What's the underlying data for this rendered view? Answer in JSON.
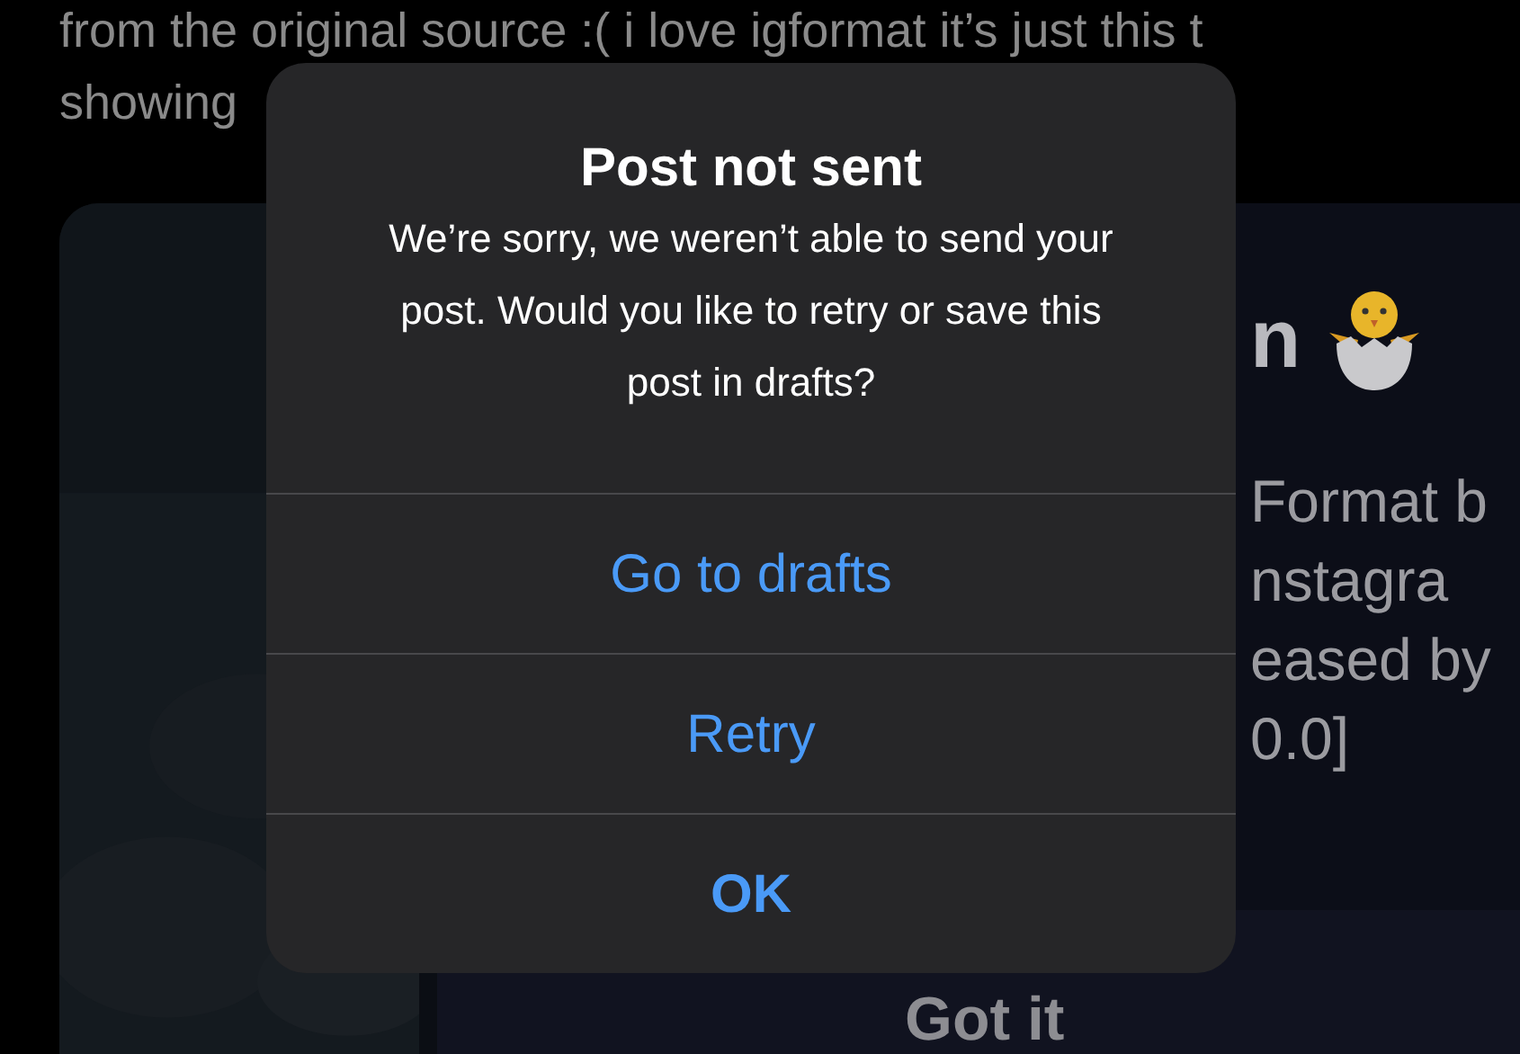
{
  "background": {
    "post_text": [
      "from the original source :(  i love igformat it’s just this t",
      "showing"
    ],
    "card": {
      "heading": "n",
      "body_lines": [
        "Format b",
        "nstagra",
        "eased by",
        "0.0]"
      ],
      "button": "Got it"
    }
  },
  "dialog": {
    "title": "Post not sent",
    "message": "We’re sorry, we weren’t able to send your post. Would you like to retry or save this post in drafts?",
    "buttons": [
      {
        "label": "Go to drafts",
        "emphasized": false
      },
      {
        "label": "Retry",
        "emphasized": false
      },
      {
        "label": "OK",
        "emphasized": true
      }
    ]
  }
}
